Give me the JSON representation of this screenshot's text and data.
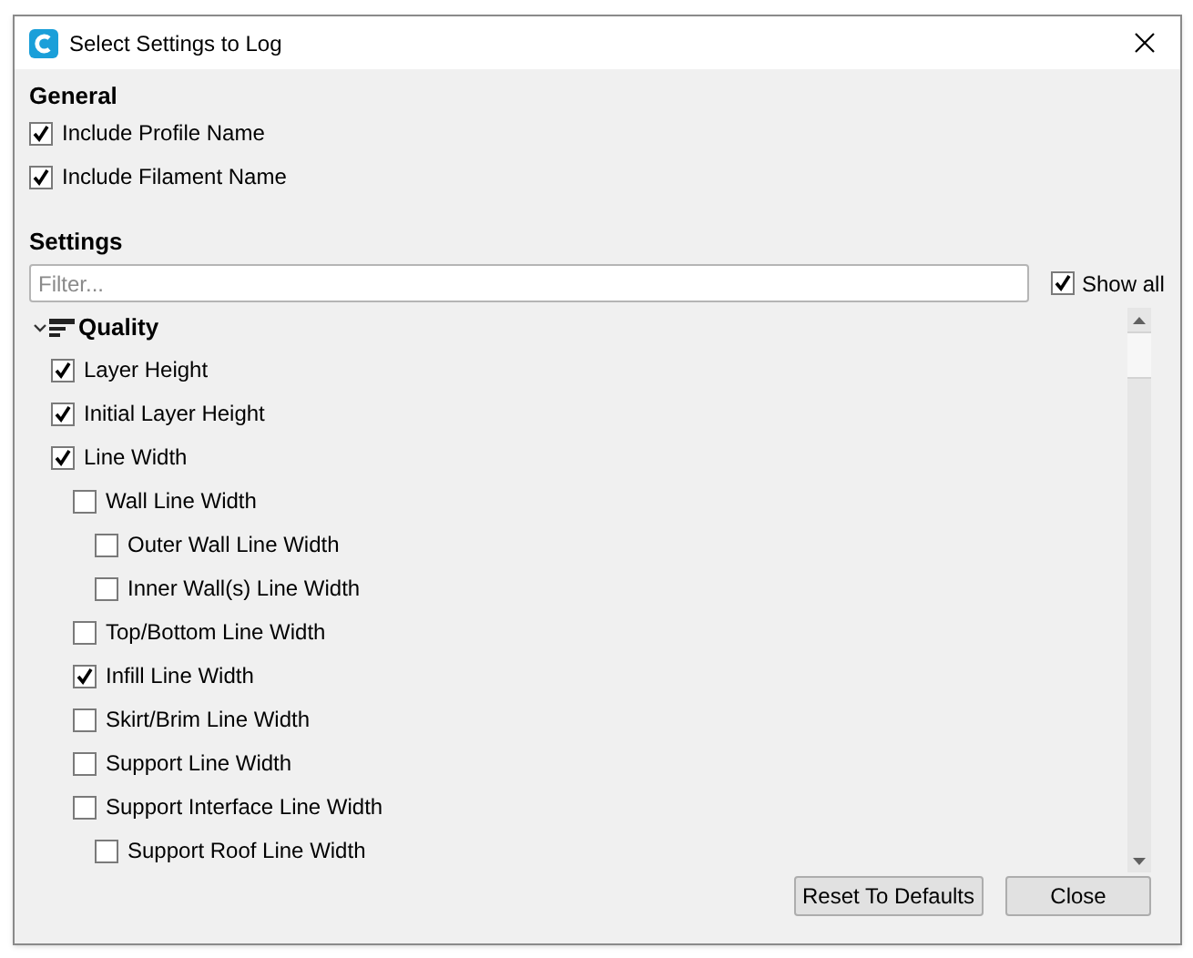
{
  "window": {
    "title": "Select Settings to Log"
  },
  "general": {
    "heading": "General",
    "options": [
      {
        "label": "Include Profile Name",
        "checked": true
      },
      {
        "label": "Include Filament Name",
        "checked": true
      }
    ]
  },
  "settings": {
    "heading": "Settings",
    "filter": {
      "placeholder": "Filter..."
    },
    "show_all": {
      "label": "Show all",
      "checked": true
    },
    "tree": [
      {
        "label": "Quality",
        "kind": "category",
        "expanded": true,
        "children": [
          {
            "label": "Layer Height",
            "kind": "setting",
            "checked": true
          },
          {
            "label": "Initial Layer Height",
            "kind": "setting",
            "checked": true
          },
          {
            "label": "Line Width",
            "kind": "setting",
            "checked": true,
            "children": [
              {
                "label": "Wall Line Width",
                "kind": "setting",
                "checked": false,
                "children": [
                  {
                    "label": "Outer Wall Line Width",
                    "kind": "setting",
                    "checked": false
                  },
                  {
                    "label": "Inner Wall(s) Line Width",
                    "kind": "setting",
                    "checked": false
                  }
                ]
              },
              {
                "label": "Top/Bottom Line Width",
                "kind": "setting",
                "checked": false
              },
              {
                "label": "Infill Line Width",
                "kind": "setting",
                "checked": true
              },
              {
                "label": "Skirt/Brim Line Width",
                "kind": "setting",
                "checked": false
              },
              {
                "label": "Support Line Width",
                "kind": "setting",
                "checked": false
              },
              {
                "label": "Support Interface Line Width",
                "kind": "setting",
                "checked": false,
                "children": [
                  {
                    "label": "Support Roof Line Width",
                    "kind": "setting",
                    "checked": false
                  }
                ]
              }
            ]
          }
        ]
      }
    ]
  },
  "buttons": [
    {
      "label": "Reset To Defaults"
    },
    {
      "label": "Close"
    }
  ]
}
